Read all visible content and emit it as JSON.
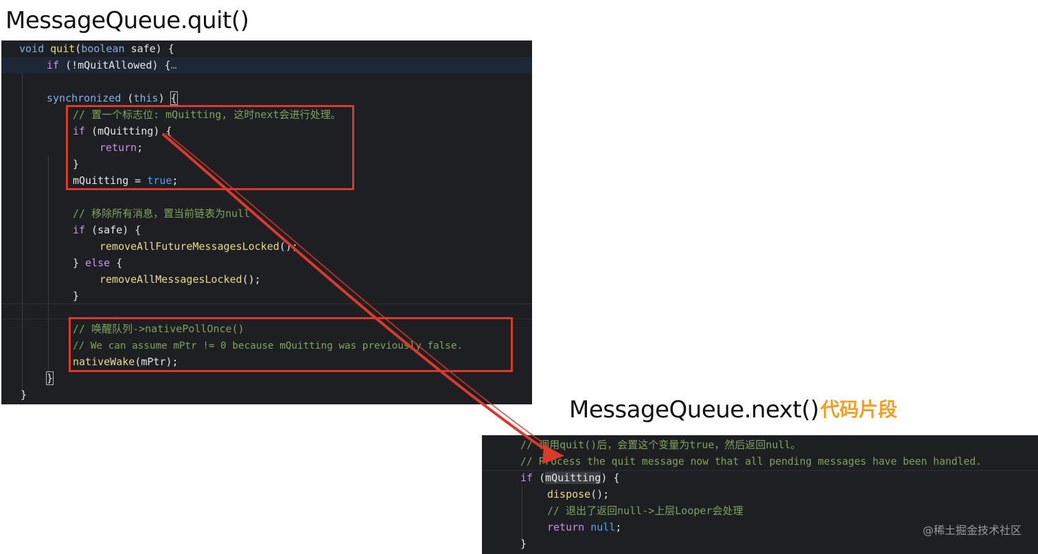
{
  "titles": {
    "quit": "MessageQueue.quit()",
    "next": "MessageQueue.next()",
    "next_tag": "代码片段"
  },
  "quit_code": {
    "l1": {
      "a": "void ",
      "b": "quit",
      "c": "(",
      "d": "boolean ",
      "e": "safe) {"
    },
    "l2": {
      "a": "if ",
      "b": "(!mQuitAllowed) {",
      "c": "…"
    },
    "l3": {
      "a": "synchronized ",
      "b": "(",
      "c": "this",
      "d": ") ",
      "e": "{"
    },
    "l4": "// 置一个标志位: mQuitting, 这时next会进行处理。",
    "l5": {
      "a": "if ",
      "b": "(mQuitting) {"
    },
    "l6": {
      "a": "return",
      "b": ";"
    },
    "l7": "}",
    "l8": {
      "a": "mQuitting = ",
      "b": "true",
      "c": ";"
    },
    "l9": "// 移除所有消息，置当前链表为null",
    "l10": {
      "a": "if ",
      "b": "(safe) {"
    },
    "l11": {
      "a": "removeAllFutureMessagesLocked",
      "b": "();"
    },
    "l12": {
      "a": "} ",
      "b": "else ",
      "c": "{"
    },
    "l13": {
      "a": "removeAllMessagesLocked",
      "b": "();"
    },
    "l14": "}",
    "l15": "// 唤醒队列->nativePollOnce()",
    "l16": "// We can assume mPtr != 0 because mQuitting was previously false.",
    "l17": {
      "a": "nativeWake",
      "b": "(mPtr);"
    },
    "l18": "}",
    "l19": "}"
  },
  "next_code": {
    "l1": "// 调用quit()后，会置这个变量为true，然后返回null。",
    "l2": "// Process the quit message now that all pending messages have been handled.",
    "l3": {
      "a": "if ",
      "b": "(",
      "c": "mQuitting",
      "d": ") {"
    },
    "l4": {
      "a": "dispose",
      "b": "();"
    },
    "l5": "// 退出了返回null->上层Looper会处理",
    "l6": {
      "a": "return ",
      "b": "null",
      "c": ";"
    },
    "l7": "}"
  },
  "watermark": "@稀土掘金技术社区",
  "colors": {
    "code_bg": "#1e1f22",
    "red_annotation": "#d93a2b",
    "tag_orange": "#f0a028",
    "comment": "#7fa35a",
    "keyword": "#c792ea",
    "function": "#e9d98a",
    "literal": "#4ea3f0"
  }
}
